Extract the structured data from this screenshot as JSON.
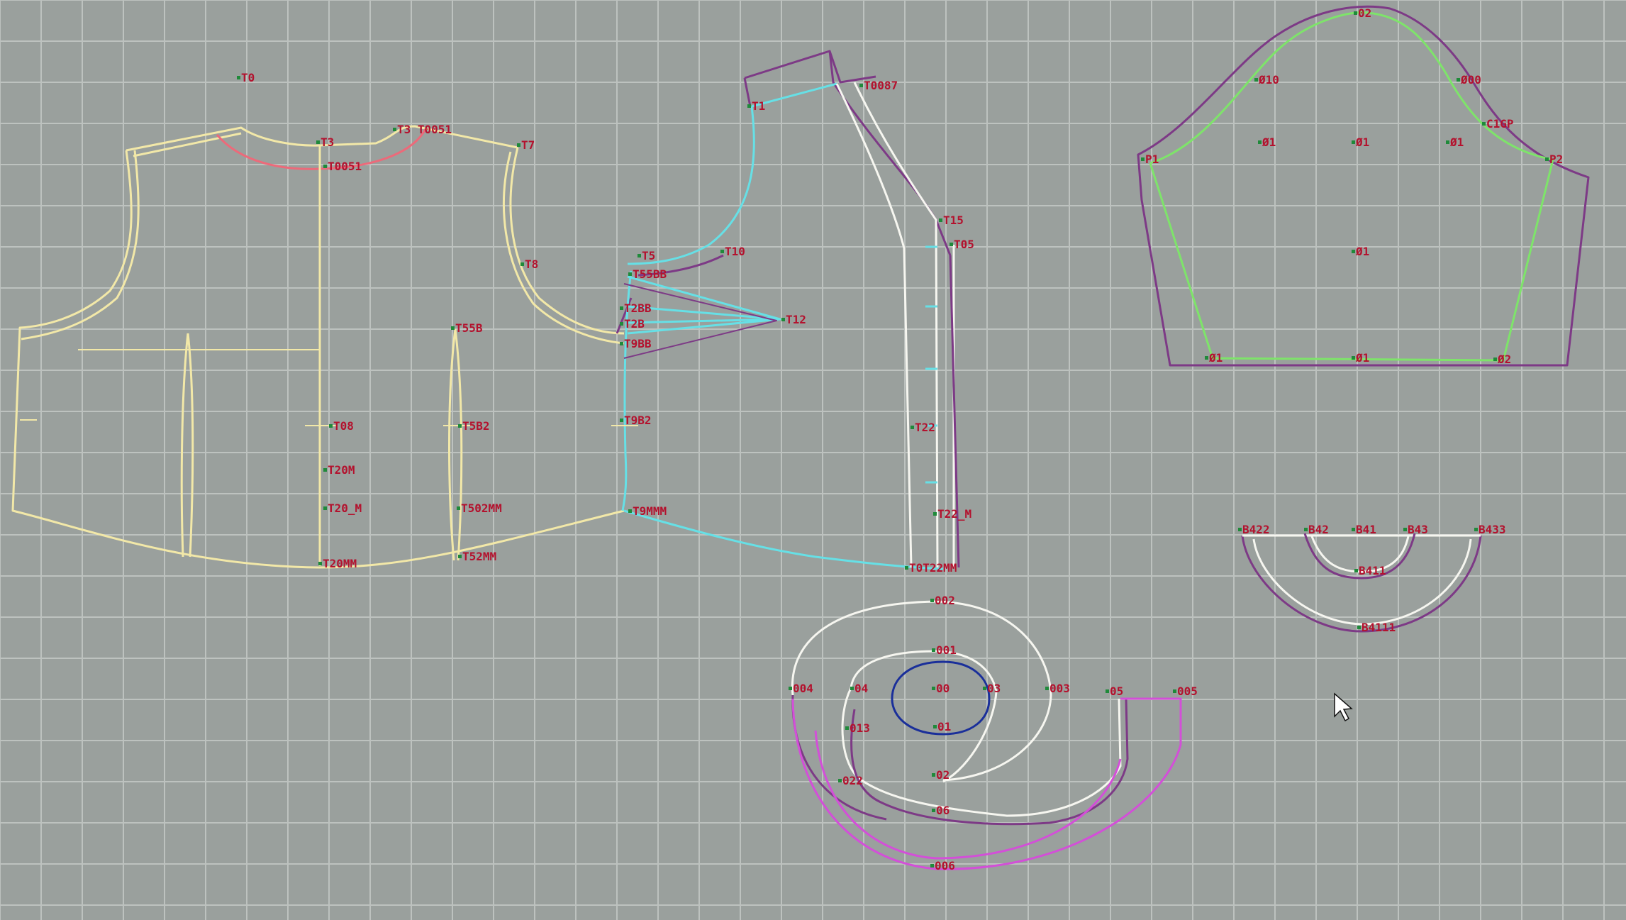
{
  "app": {
    "view": "pattern drafting workspace",
    "grid": true,
    "colors": {
      "background": "#9aa09d",
      "grid_line": "#c6cbc8",
      "outline_cream": "#f2e8a8",
      "outline_white": "#f6f6f0",
      "outline_cyan": "#66e0e6",
      "outline_green": "#7ee46a",
      "outline_purple": "#7d3a86",
      "outline_magenta": "#d34fd8",
      "outline_pink": "#ec6a7a",
      "outline_blue": "#1a2f9a",
      "label_red": "#b3122e",
      "point_green": "#1f8a3a"
    }
  },
  "labels": {
    "t0": "T0",
    "t3_top": "T3",
    "t3_1": "T3 T0051",
    "t0051": "T0051",
    "t7": "T7",
    "t8": "T8",
    "t08": "T08",
    "t20m": "T20M",
    "t20_m": "T20_M",
    "t20mm": "T20MM",
    "t55b": "T55B",
    "t5b2": "T5B2",
    "t502mm": "T502MM",
    "t52mm": "T52MM",
    "t0087": "T0087",
    "t1": "T1",
    "t10": "T10",
    "t5": "T5",
    "t55bb": "T55BB",
    "t2bb": "T2BB",
    "t2b": "T2B",
    "t12": "T12",
    "t9bb": "T9BB",
    "t9mmm": "T9MMM",
    "t9b2": "T9B2",
    "t15": "T15",
    "t05": "T05",
    "t22": "T22",
    "t22_m": "T22_M",
    "t0t22m": "T0T22MM",
    "s0": "02",
    "s10": "Ø10",
    "s00": "Ø00",
    "s1gp": "C1GP",
    "s11": "Ø1",
    "s_mid": "Ø1",
    "s_r": "Ø1",
    "s1": "P1",
    "s2": "P2",
    "s_c": "Ø1",
    "s_bl": "Ø1",
    "s_bm": "Ø1",
    "s_br": "Ø2",
    "c002": "002",
    "c001": "001",
    "c004": "004",
    "c04": "04",
    "c00": "00",
    "c03": "03",
    "c003": "003",
    "c05": "05",
    "c005": "005",
    "c013": "013",
    "c01": "01",
    "c02": "02",
    "c022": "022",
    "c06": "06",
    "c006": "006",
    "b422": "B422",
    "b42": "B42",
    "b41": "B41",
    "b43": "B43",
    "b433": "B433",
    "b411": "B411",
    "b4111": "B4111"
  }
}
